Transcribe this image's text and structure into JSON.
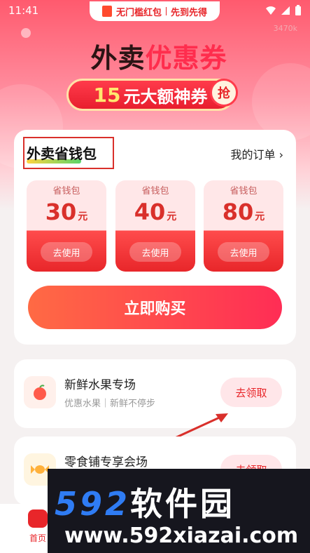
{
  "status": {
    "time": "11:41"
  },
  "promo": {
    "left": "无门槛红包",
    "right": "先到先得"
  },
  "counter": "3470k",
  "hero": {
    "title_a": "外卖",
    "title_b": "优惠券",
    "sub_num": "15",
    "sub_text": "元大额神券",
    "grab": "抢"
  },
  "card": {
    "title": "外卖省钱包",
    "orders": "我的订单 ›",
    "coupons": [
      {
        "head": "省钱包",
        "amount": "30",
        "unit": "元",
        "use": "去使用"
      },
      {
        "head": "省钱包",
        "amount": "40",
        "unit": "元",
        "use": "去使用"
      },
      {
        "head": "省钱包",
        "amount": "80",
        "unit": "元",
        "use": "去使用"
      }
    ],
    "buy": "立即购买"
  },
  "venues": [
    {
      "title": "新鲜水果专场",
      "sub": "优惠水果｜新鲜不停步",
      "btn": "去领取",
      "icon": "apple-icon"
    },
    {
      "title": "零食铺专享会场",
      "sub": "",
      "btn": "去领取",
      "icon": "candy-icon"
    }
  ],
  "tabbar": {
    "home": "首页"
  },
  "watermark": {
    "num": "592",
    "text": "软件园",
    "url": "www.592xiazai.com"
  },
  "colors": {
    "accent": "#e8262a",
    "brand_gradient": [
      "#ff6a44",
      "#ff2d55"
    ]
  }
}
